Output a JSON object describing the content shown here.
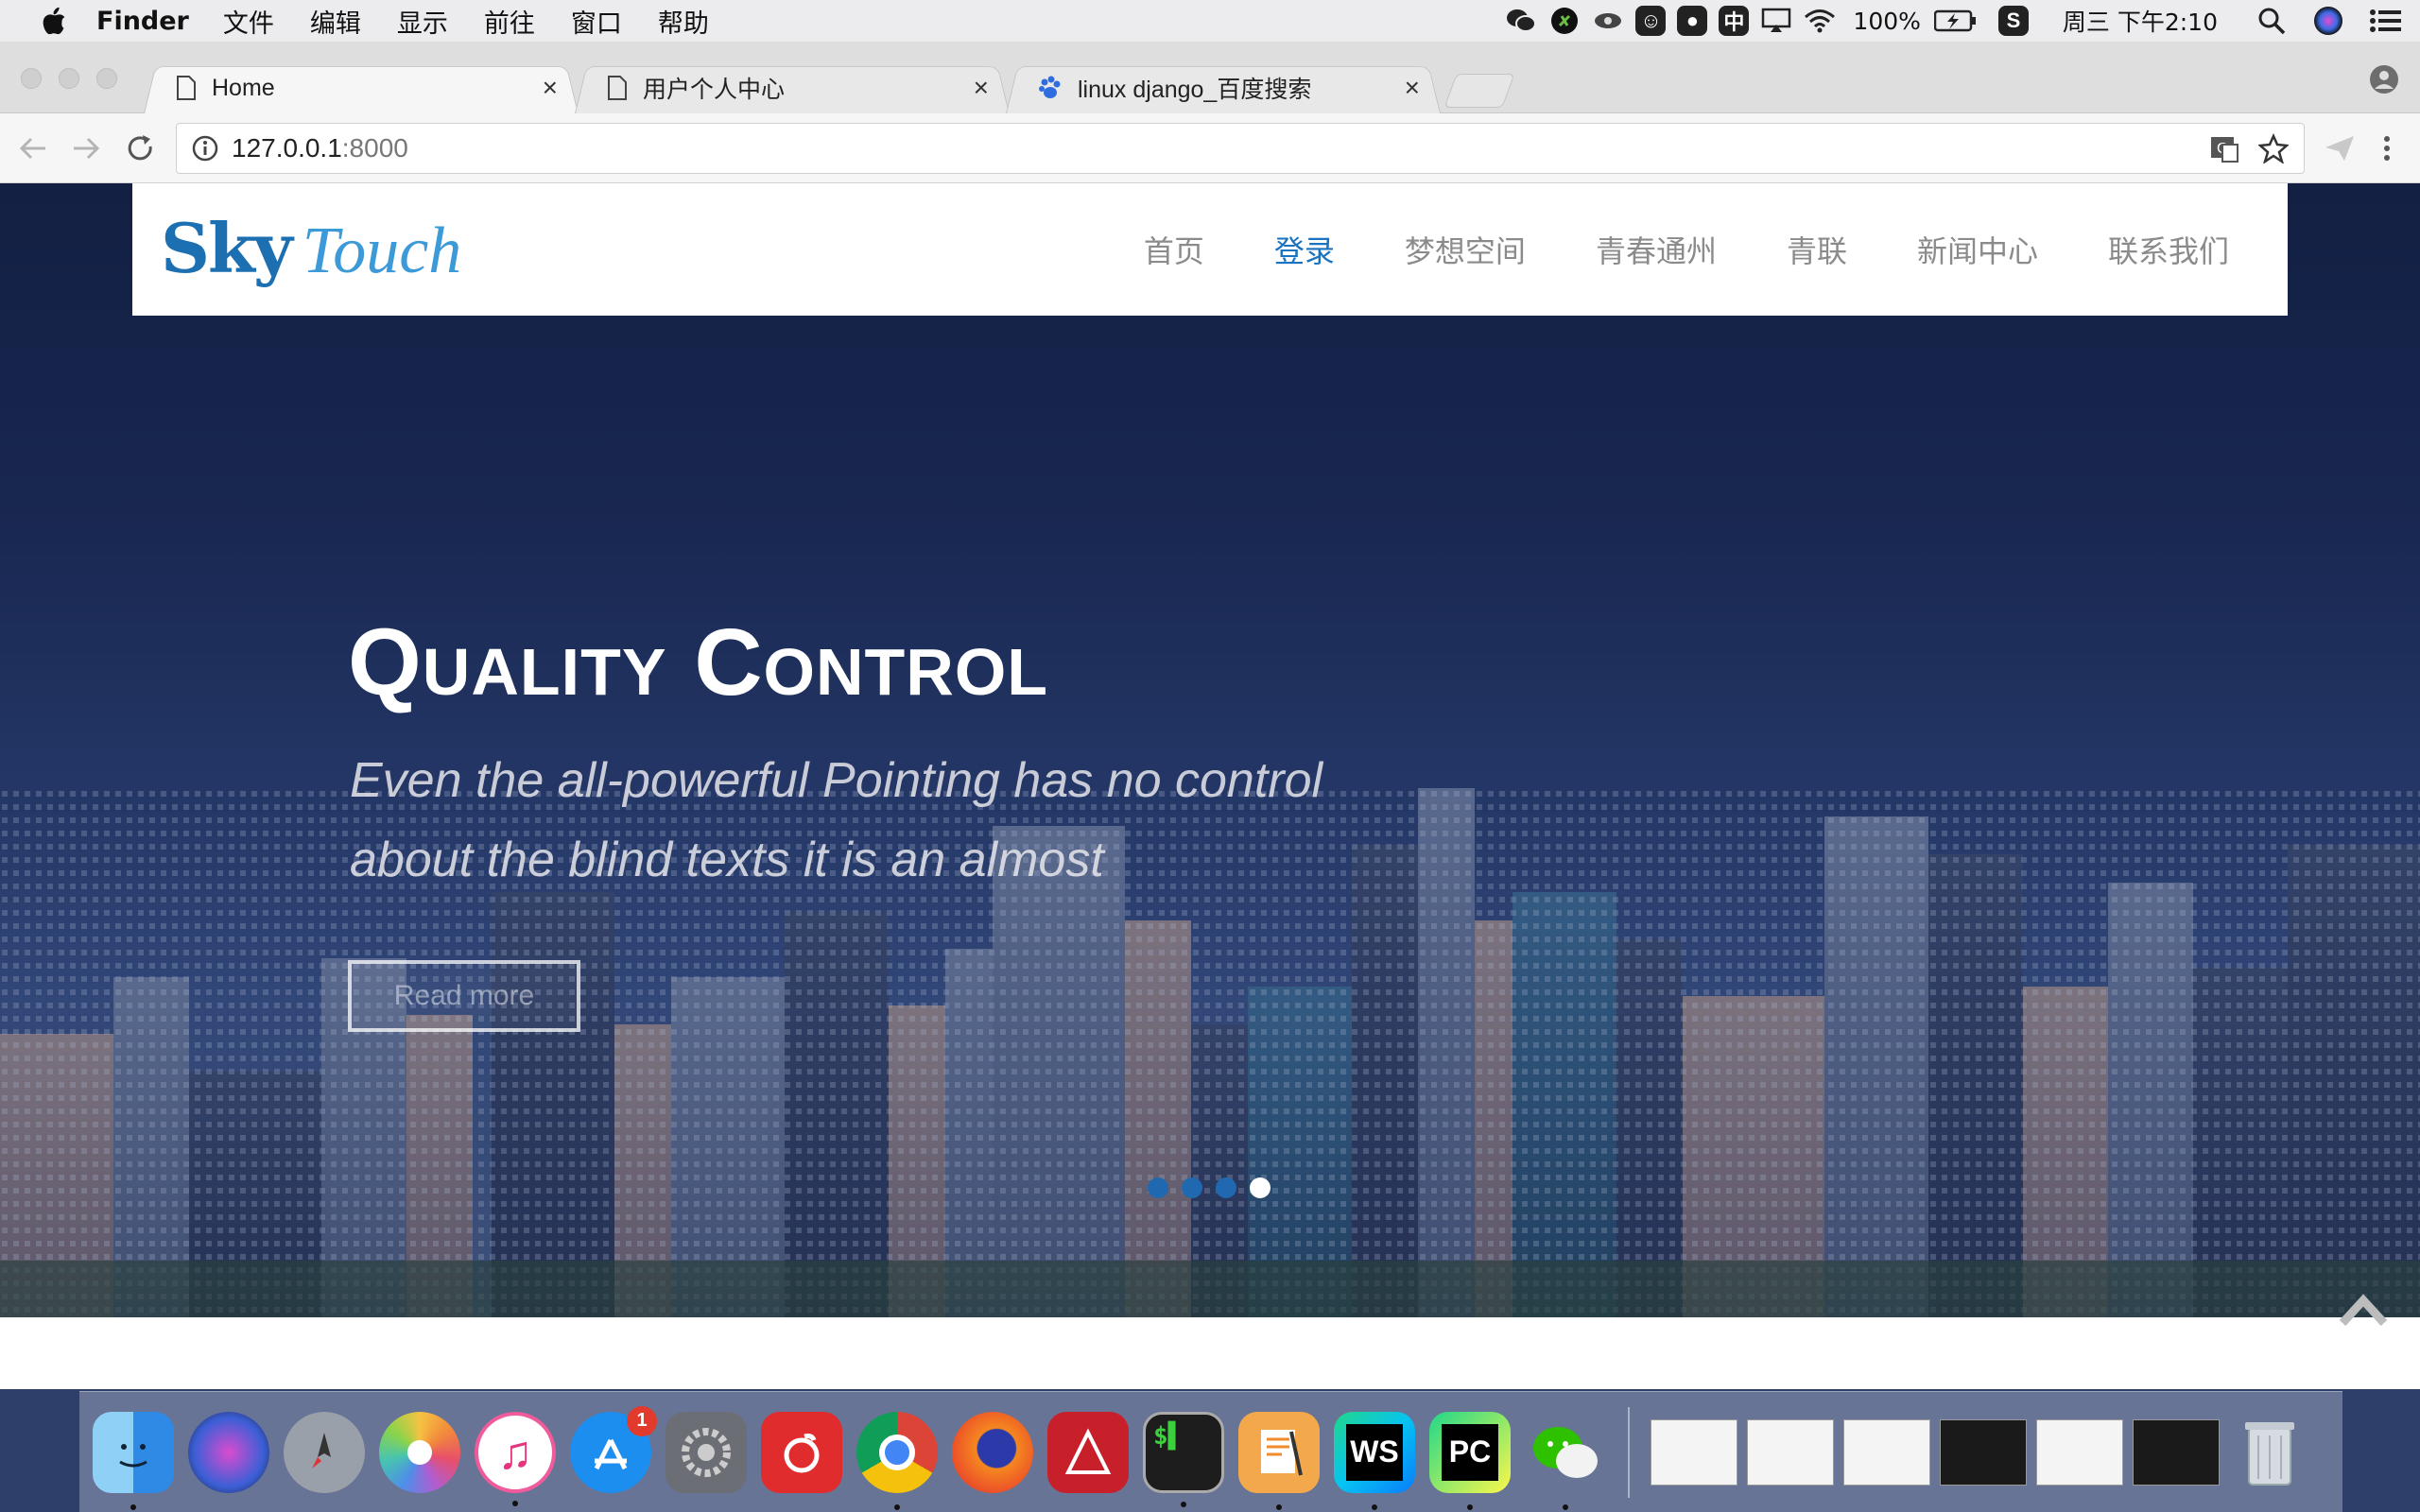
{
  "menubar": {
    "app_name": "Finder",
    "items": [
      "文件",
      "编辑",
      "显示",
      "前往",
      "窗口",
      "帮助"
    ],
    "battery": "100%",
    "clock": "周三 下午2:10",
    "input_method": "中"
  },
  "browser": {
    "tabs": [
      {
        "title": "Home",
        "close": "×",
        "active": true
      },
      {
        "title": "用户个人中心",
        "close": "×",
        "active": false
      },
      {
        "title": "linux django_百度搜索",
        "close": "×",
        "active": false
      }
    ],
    "url_host": "127.0.0.1",
    "url_port": ":8000"
  },
  "site": {
    "logo_sky": "Sky",
    "logo_touch": "Touch",
    "nav": [
      "首页",
      "登录",
      "梦想空间",
      "青春通州",
      "青联",
      "新闻中心",
      "联系我们"
    ],
    "active_nav": "登录"
  },
  "hero": {
    "title": "Quality Control",
    "subtitle": "Even the all-powerful Pointing has no control about the blind texts it is an almost",
    "button": "Read more",
    "slides_total": 4,
    "slide_active": 4
  },
  "dock": {
    "apps": [
      "finder-icon",
      "siri-icon",
      "launchpad-icon",
      "photos-icon",
      "itunes-icon",
      "app-store-icon",
      "system-preferences-icon",
      "netease-music-icon",
      "chrome-icon",
      "firefox-icon",
      "autocad-icon",
      "terminal-icon",
      "pages-icon",
      "webstorm-icon",
      "pycharm-icon",
      "wechat-icon"
    ],
    "app_store_badge": "1",
    "webstorm_label": "WS",
    "pycharm_label": "PC"
  },
  "colors": {
    "nav_active": "#1a73c0",
    "nav_text": "#8b8b8b",
    "dot": "#2069b0",
    "hero_bg": "#1b2a55"
  }
}
